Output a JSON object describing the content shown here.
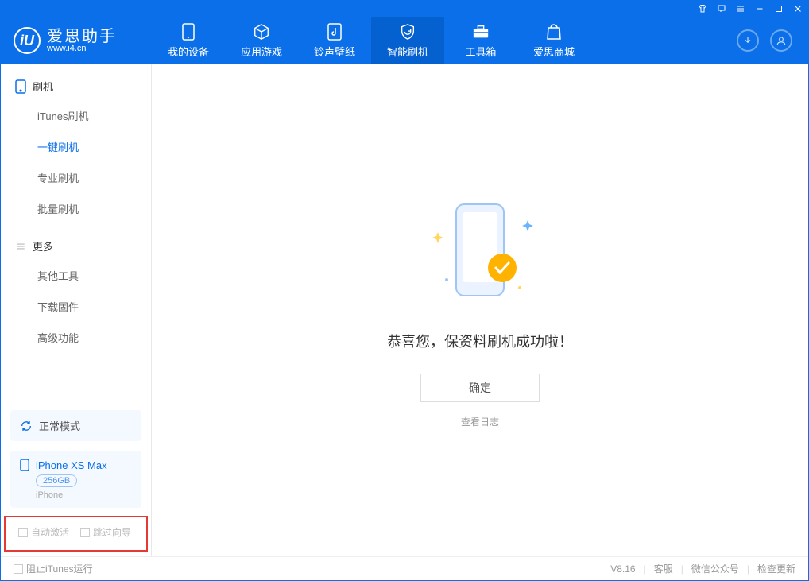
{
  "header": {
    "title": "爱思助手",
    "url": "www.i4.cn",
    "nav": [
      "我的设备",
      "应用游戏",
      "铃声壁纸",
      "智能刷机",
      "工具箱",
      "爱思商城"
    ]
  },
  "sidebar": {
    "section1": "刷机",
    "items1": [
      "iTunes刷机",
      "一键刷机",
      "专业刷机",
      "批量刷机"
    ],
    "section2": "更多",
    "items2": [
      "其他工具",
      "下载固件",
      "高级功能"
    ]
  },
  "device": {
    "mode": "正常模式",
    "name": "iPhone XS Max",
    "storage": "256GB",
    "type": "iPhone"
  },
  "options": {
    "auto_activate": "自动激活",
    "skip_wizard": "跳过向导"
  },
  "main": {
    "message": "恭喜您，保资料刷机成功啦！",
    "ok_button": "确定",
    "view_log": "查看日志"
  },
  "footer": {
    "block_itunes": "阻止iTunes运行",
    "version": "V8.16",
    "links": [
      "客服",
      "微信公众号",
      "检查更新"
    ]
  }
}
